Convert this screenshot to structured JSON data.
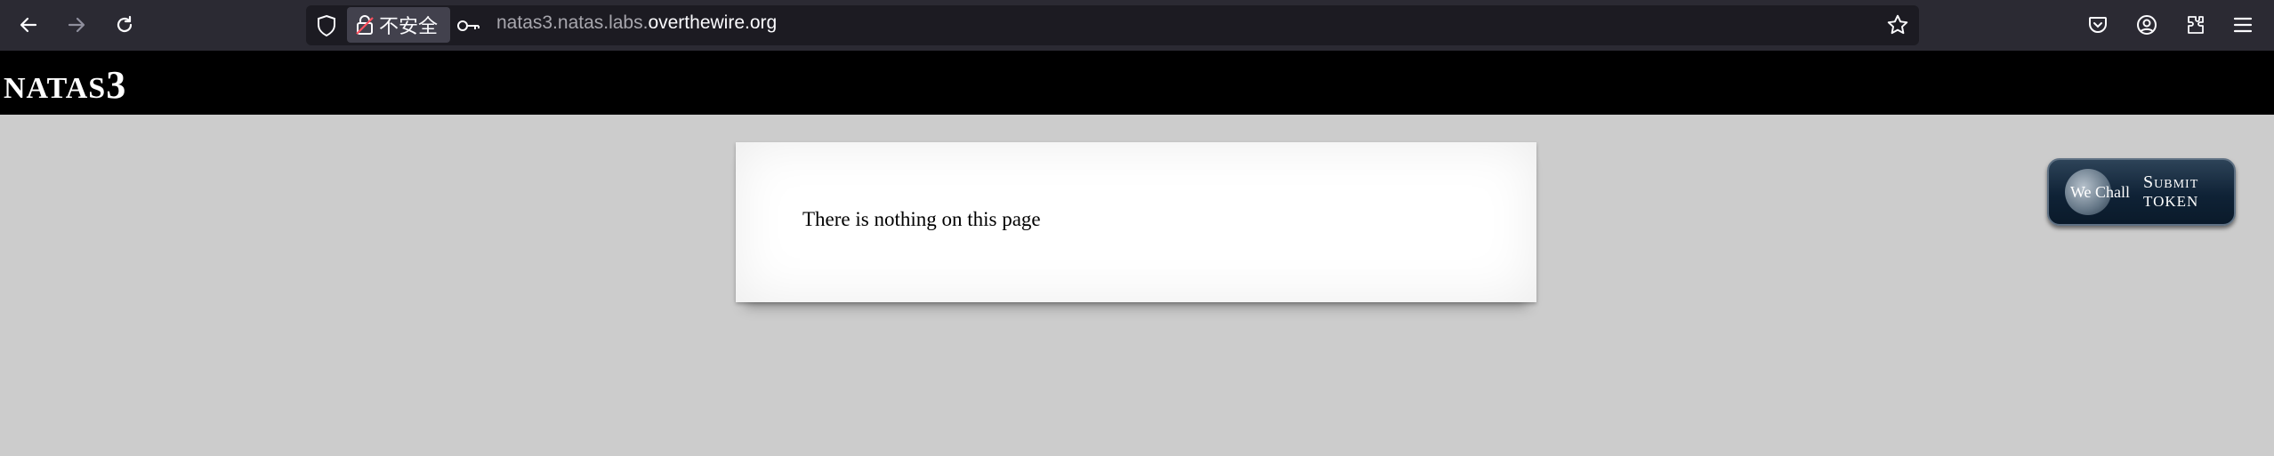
{
  "browser": {
    "security_label": "不安全",
    "url_prefix": "natas3.natas.labs.",
    "url_domain": "overthewire.org",
    "icons": [
      "back-icon",
      "forward-icon",
      "reload-icon",
      "shield-icon",
      "insecure-lock-icon",
      "key-icon",
      "star-icon",
      "pocket-icon",
      "account-icon",
      "extensions-icon",
      "menu-icon"
    ]
  },
  "header": {
    "title_small": "NATAS",
    "title_number": "3"
  },
  "content": {
    "text": "There is nothing on this page"
  },
  "wechall": {
    "logo_text": "We Chall",
    "submit_line1": "Submit",
    "submit_line2": "TOKEN"
  },
  "colors": {
    "toolbar_bg": "#2b2a33",
    "urlbar_bg": "#1c1b22",
    "page_bg": "#cccccc",
    "header_bg": "#000000",
    "button_bg": "#0f2236"
  }
}
